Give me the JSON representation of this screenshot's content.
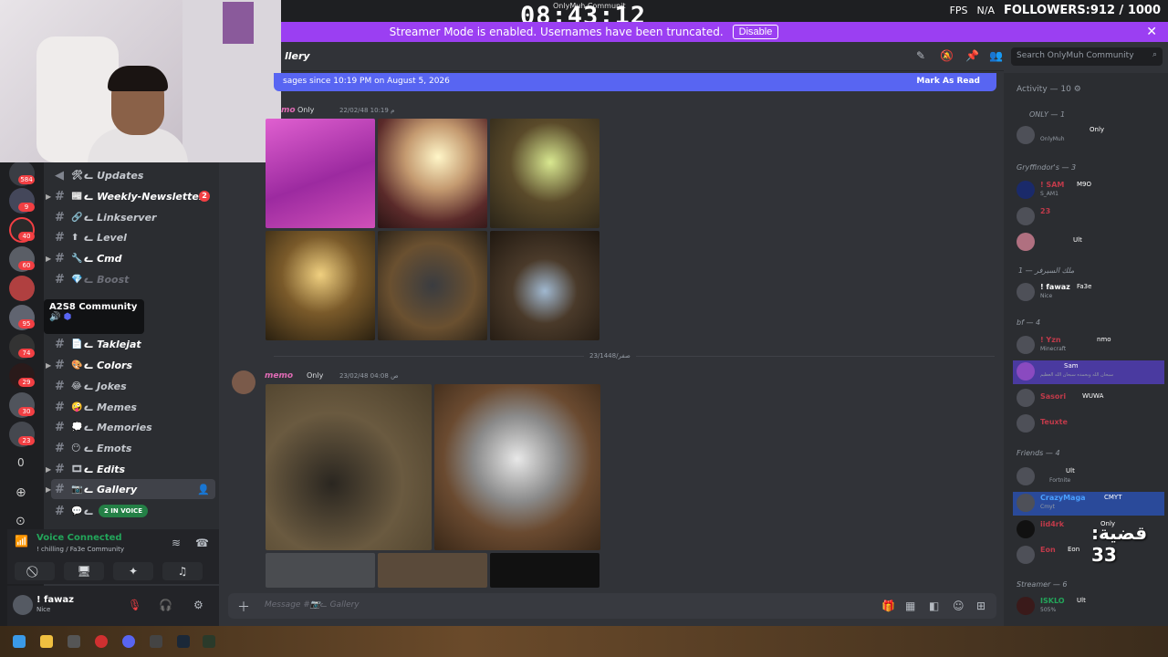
{
  "overlay": {
    "clock": "08:43:12",
    "fps_label": "FPS",
    "fps_value": "N/A",
    "followers": "FOLLOWERS:912 / 1000",
    "top_title": "OnlyMuh Communit",
    "qadiya": "قضية: 33"
  },
  "streamer_banner": {
    "text": "Streamer Mode is enabled. Usernames have been truncated.",
    "disable_label": "Disable"
  },
  "header": {
    "channel_title": "llery",
    "search_placeholder": "Search OnlyMuh Community"
  },
  "new_messages": {
    "text": "sages since 10:19 PM on August 5, 2026",
    "mark_read": "Mark As Read"
  },
  "rail": {
    "badges": [
      "584",
      "9",
      "40",
      "60",
      "95",
      "74",
      "29",
      "30",
      "23"
    ],
    "counter": "0"
  },
  "tooltip": {
    "title": "A2S8 Community"
  },
  "channels": [
    {
      "label": "ᓚ Updates",
      "emoji": "🛠"
    },
    {
      "label": "ᓚ Weekly-Newsletter",
      "emoji": "📰",
      "badge": "2"
    },
    {
      "label": "ᓚ Linkserver",
      "emoji": "🔗"
    },
    {
      "label": "ᓚ Level",
      "emoji": "⬆"
    },
    {
      "label": "ᓚ Cmd",
      "emoji": "🔧"
    },
    {
      "label": "ᓚ Boost",
      "emoji": "💎"
    },
    {
      "label": "ᓚ Taklejat",
      "emoji": "📄"
    },
    {
      "label": "ᓚ Colors",
      "emoji": "🎨"
    },
    {
      "label": "ᓚ Jokes",
      "emoji": "😂"
    },
    {
      "label": "ᓚ Memes",
      "emoji": "🤪"
    },
    {
      "label": "ᓚ Memories",
      "emoji": "💭"
    },
    {
      "label": "ᓚ Emots",
      "emoji": "😶"
    },
    {
      "label": "ᓚ Edits",
      "emoji": "🎞"
    },
    {
      "label": "ᓚ Gallery",
      "emoji": "📷"
    },
    {
      "label": "ᓚ",
      "emoji": "💬"
    }
  ],
  "voice_pill": "2 IN VOICE",
  "voice_panel": {
    "status": "Voice Connected",
    "sub": "! chilling / Fa3e Community"
  },
  "user_panel": {
    "name": "! fawaz",
    "status": "Nice"
  },
  "messages": [
    {
      "author": "mo",
      "role": "Only",
      "time": "22/02/48 10:19 م"
    },
    {
      "author": "memo",
      "role": "Only",
      "time": "23/02/48 04:08 ص"
    }
  ],
  "divider_label": "23/1448/صفر",
  "composer_placeholder": "Message #📷ᓚ Gallery",
  "members": {
    "activity": "Activity — 10",
    "groups": [
      {
        "label": "ONLY — 1"
      },
      {
        "label": "Gryffindor's — 3"
      },
      {
        "label": "ملك السيرفر — 1"
      },
      {
        "label": "bf — 4"
      },
      {
        "label": "Friends — 4"
      },
      {
        "label": "Streamer — 6"
      }
    ],
    "items": [
      {
        "name": "",
        "tag": "Only",
        "sub": "OnlyMuh"
      },
      {
        "name": "! SAM",
        "tag": "M9O",
        "sub": "S_AM1"
      },
      {
        "name": "23",
        "tag": "",
        "sub": ""
      },
      {
        "name": "",
        "tag": "Ult",
        "sub": ""
      },
      {
        "name": "! fawaz",
        "tag": "Fa3e",
        "sub": "Nice"
      },
      {
        "name": "! Yzn",
        "tag": "nmo",
        "sub": "Minecraft"
      },
      {
        "name": "",
        "tag": "Sam",
        "sub": "سبحان الله وبحمده سبحان الله العظيم"
      },
      {
        "name": "Sasori",
        "tag": "WUWA",
        "sub": ""
      },
      {
        "name": "Teuxte",
        "tag": "",
        "sub": ""
      },
      {
        "name": "",
        "tag": "Ult",
        "sub": "Fortnite"
      },
      {
        "name": "CrazyMaga",
        "tag": "CMYT",
        "sub": "Cmyt"
      },
      {
        "name": "iid4rk",
        "tag": "Only",
        "sub": ""
      },
      {
        "name": "Eon",
        "tag": "Eon",
        "sub": ""
      },
      {
        "name": "ISKLO",
        "tag": "Ult",
        "sub": "505%"
      }
    ]
  },
  "colors": {
    "banner": "#9b3ff2",
    "new_bar": "#5865f2",
    "voice_green": "#23a55a",
    "badge_red": "#f23f43"
  }
}
